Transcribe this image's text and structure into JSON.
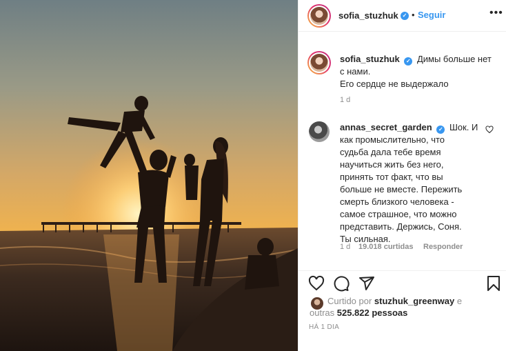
{
  "post": {
    "author": "sofia_stuzhuk",
    "follow_label": "Seguir",
    "header_dot": "•",
    "more_icon": "more-horizontal-icon",
    "verified_mark": "✓",
    "caption_line1": "Димы больше нет",
    "caption_line2": "с нами.",
    "caption_line3": "Его сердце не выдержало",
    "caption_age": "1 d"
  },
  "comment": {
    "author": "annas_secret_garden",
    "lines": [
      "Шок. И",
      "как промыслительно, что",
      "судьба дала тебе время",
      "научиться жить без него,",
      "принять тот факт, что вы",
      "больше не вместе. Пережить",
      "смерть близкого человека -",
      "самое страшное, что можно",
      "представить. Держись, Соня.",
      "Ты сильная."
    ],
    "age": "1 d",
    "likes": "19.018 curtidas",
    "reply_label": "Responder"
  },
  "likes": {
    "prefix": "Curtido por ",
    "user": "stuzhuk_greenway",
    "suffix": " e",
    "line2_prefix": "outras ",
    "count": "525.822 pessoas"
  },
  "date_label": "HÁ 1 DIA",
  "colors": {
    "accent": "#3897f0",
    "muted": "#8e8e8e",
    "text": "#262626",
    "border": "#efefef"
  }
}
